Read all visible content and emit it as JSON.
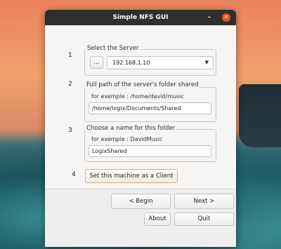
{
  "window": {
    "title": "Simple NFS GUI"
  },
  "steps": {
    "one": "1",
    "two": "2",
    "three": "3",
    "four": "4"
  },
  "server": {
    "legend": "Select the Server",
    "browse_label": "...",
    "selected": "192.168.1.10"
  },
  "shared_path": {
    "legend": "Full path of the server's folder shared",
    "hint": "for exemple : /home/david/music",
    "value": "/home/logix/Documents/Shared"
  },
  "folder_name": {
    "legend": "Choose a name for this folder",
    "hint": "for exemple : DavidMusic",
    "value": "LogixShared"
  },
  "client_button": "Set this machine as a Client",
  "nav": {
    "begin": "< Begin",
    "next": "Next >",
    "about": "About",
    "quit": "Quit"
  },
  "icons": {
    "minimize": "minimize-icon",
    "close": "close-icon",
    "dropdown": "chevron-down-icon"
  },
  "colors": {
    "titlebar": "#2f2f2f",
    "close_button": "#e95420",
    "window_bg": "#f6f5f4"
  }
}
